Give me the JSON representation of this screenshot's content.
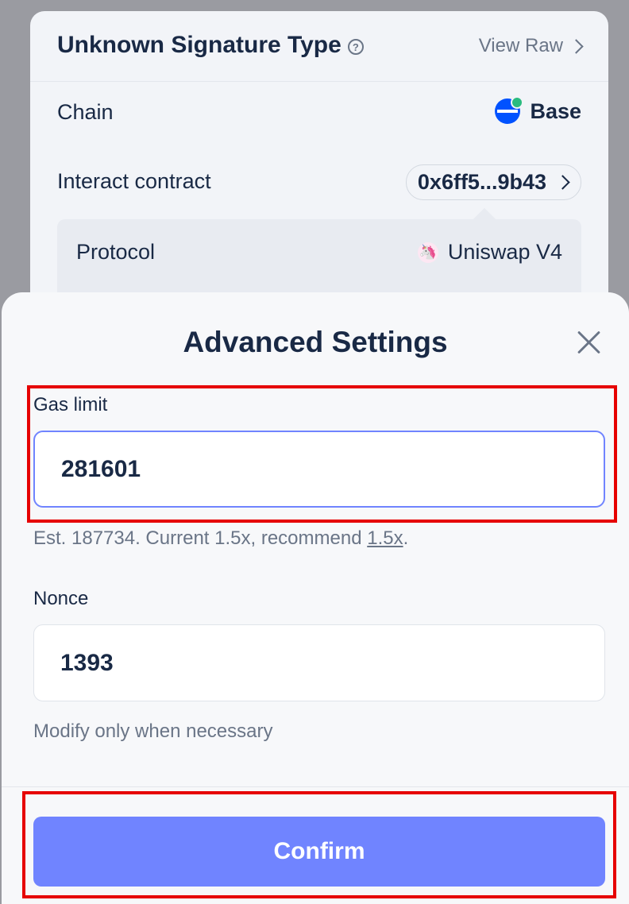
{
  "background_card": {
    "title": "Unknown Signature Type",
    "help_glyph": "?",
    "view_raw_label": "View Raw",
    "chain_label": "Chain",
    "chain_value": "Base",
    "interact_label": "Interact contract",
    "interact_value": "0x6ff5...9b43",
    "protocol_label": "Protocol",
    "protocol_value": "Uniswap V4",
    "uniswap_glyph": "🦄"
  },
  "modal": {
    "title": "Advanced Settings",
    "gas_limit": {
      "label": "Gas limit",
      "value": "281601",
      "hint_prefix": "Est. 187734. Current 1.5x, recommend ",
      "hint_link": "1.5x",
      "hint_suffix": "."
    },
    "nonce": {
      "label": "Nonce",
      "value": "1393",
      "hint": "Modify only when necessary"
    },
    "confirm_label": "Confirm"
  },
  "colors": {
    "accent": "#7084ff",
    "highlight": "#e60000",
    "text": "#192945",
    "muted": "#6a7587"
  }
}
